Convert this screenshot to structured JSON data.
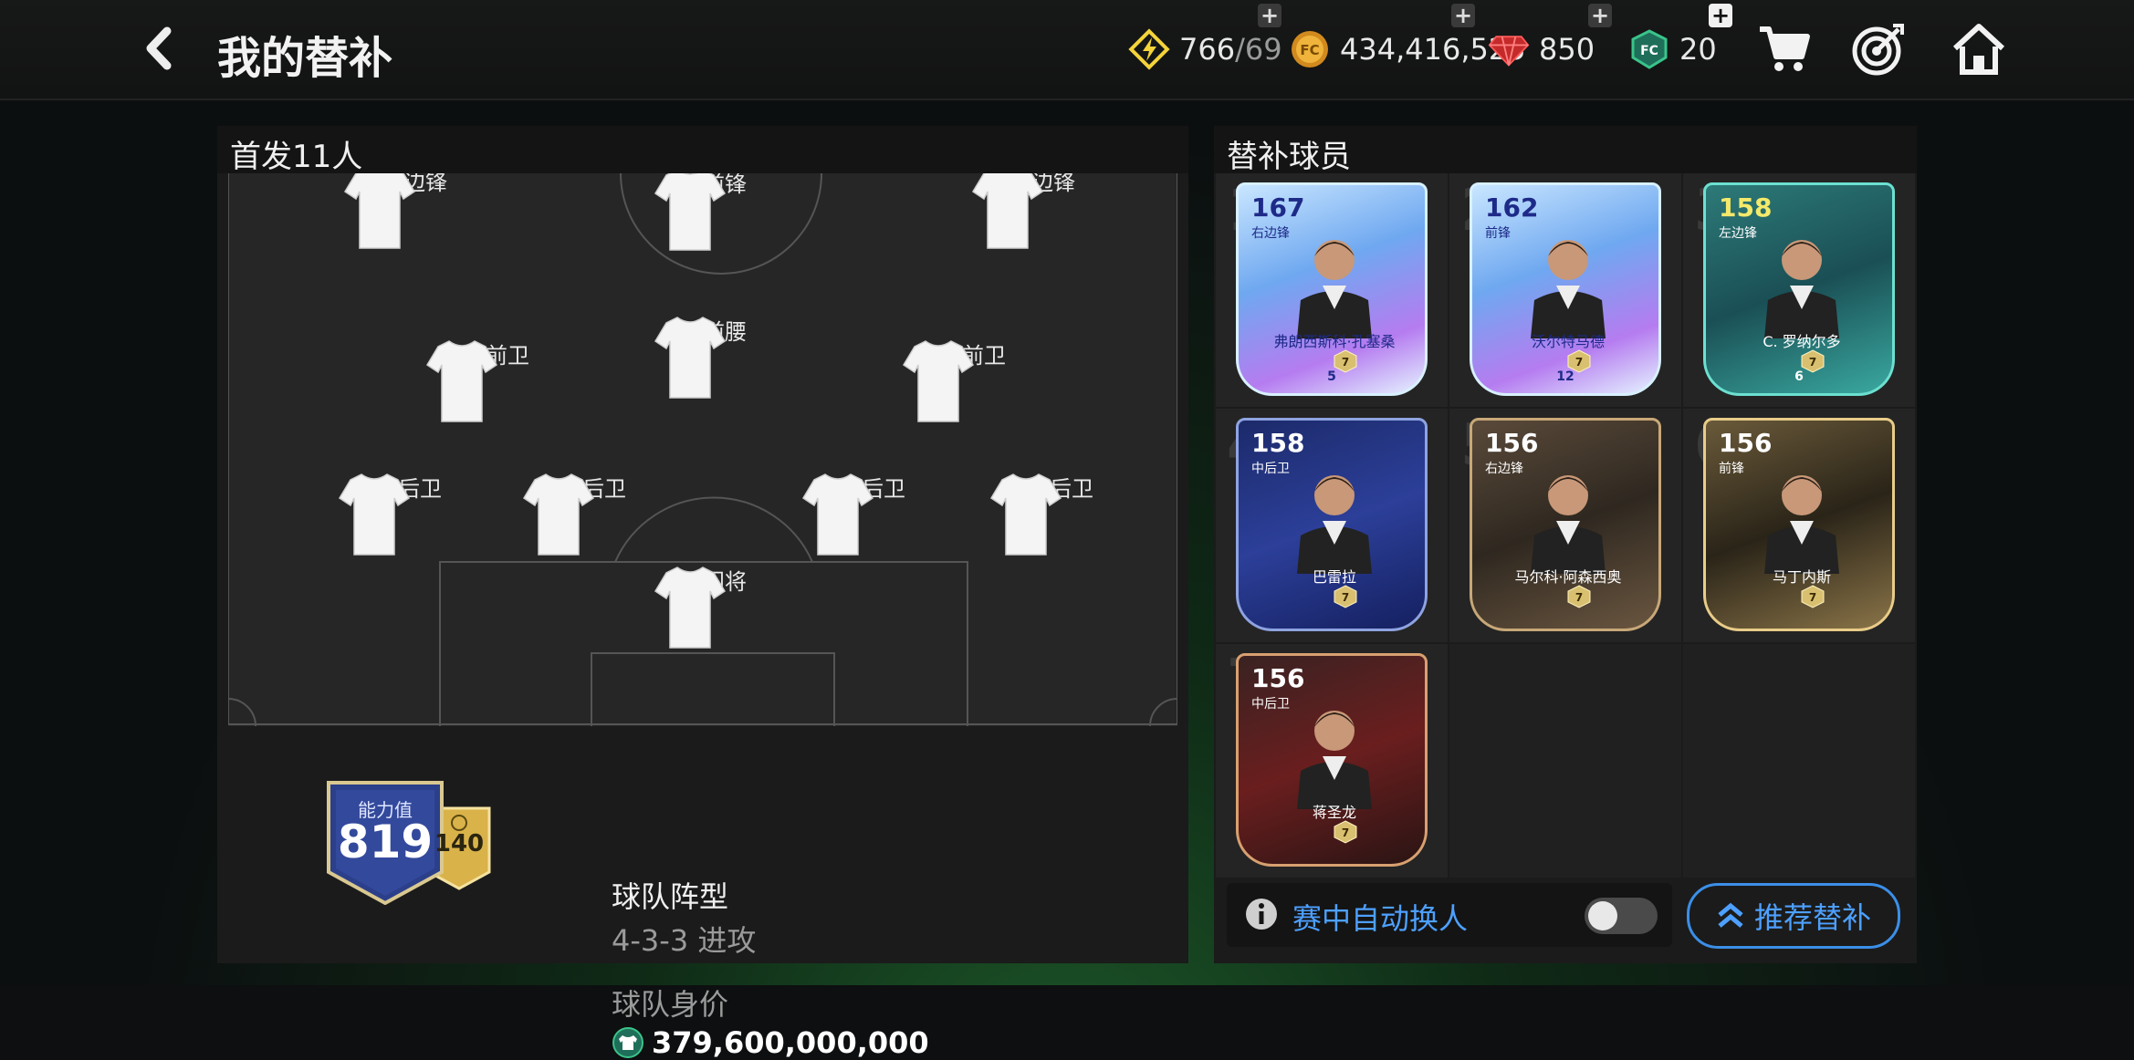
{
  "header": {
    "title": "我的替补",
    "back_icon": "chevron-left-icon",
    "currencies": [
      {
        "icon": "lightning-icon",
        "value": "766",
        "suffix": "/69",
        "color": "#f4d43a"
      },
      {
        "icon": "coin-icon",
        "value": "434,416,525",
        "color": "#e8a02a"
      },
      {
        "icon": "gem-icon",
        "value": "850",
        "color": "#e03a3a"
      },
      {
        "icon": "fc-point-icon",
        "value": "20",
        "color": "#3ac48a"
      }
    ],
    "icons": [
      "cart-icon",
      "target-icon",
      "home-icon"
    ]
  },
  "lineup": {
    "header": "首发11人",
    "positions": [
      "左边锋",
      "前锋",
      "右边锋",
      "中前卫",
      "前腰",
      "中前卫",
      "左后卫",
      "中后卫",
      "中后卫",
      "右后卫",
      "门将"
    ]
  },
  "team": {
    "rating_label": "能力值",
    "rating": "819",
    "rating_sub": "140",
    "formation_label": "球队阵型",
    "formation": "4-3-3 进攻",
    "value_label": "球队身价",
    "value": "379,600,000,000"
  },
  "subs": {
    "header": "替补球员",
    "slots": [
      {
        "num": "1",
        "ovr": "167",
        "pos": "右边锋",
        "name": "弗朗西斯科·孔塞桑",
        "grade": "5",
        "style": "ice"
      },
      {
        "num": "2",
        "ovr": "162",
        "pos": "前锋",
        "name": "沃尔特马德",
        "grade": "12",
        "style": "ice"
      },
      {
        "num": "3",
        "ovr": "158",
        "pos": "左边锋",
        "name": "C. 罗纳尔多",
        "grade": "6",
        "style": "teal"
      },
      {
        "num": "4",
        "ovr": "158",
        "pos": "中后卫",
        "name": "巴雷拉",
        "grade": "",
        "style": "navy"
      },
      {
        "num": "5",
        "ovr": "156",
        "pos": "右边锋",
        "name": "马尔科·阿森西奥",
        "grade": "",
        "style": "bronze"
      },
      {
        "num": "6",
        "ovr": "156",
        "pos": "前锋",
        "name": "马丁内斯",
        "grade": "",
        "style": "gold"
      },
      {
        "num": "7",
        "ovr": "156",
        "pos": "中后卫",
        "name": "蒋圣龙",
        "grade": "",
        "style": "star"
      },
      {
        "num": "",
        "ovr": "",
        "pos": "",
        "name": "",
        "grade": "",
        "style": "empty"
      },
      {
        "num": "",
        "ovr": "",
        "pos": "",
        "name": "",
        "grade": "",
        "style": "empty"
      }
    ],
    "auto_sub_label": "赛中自动换人",
    "auto_sub_on": false,
    "recommend_label": "推荐替补"
  }
}
